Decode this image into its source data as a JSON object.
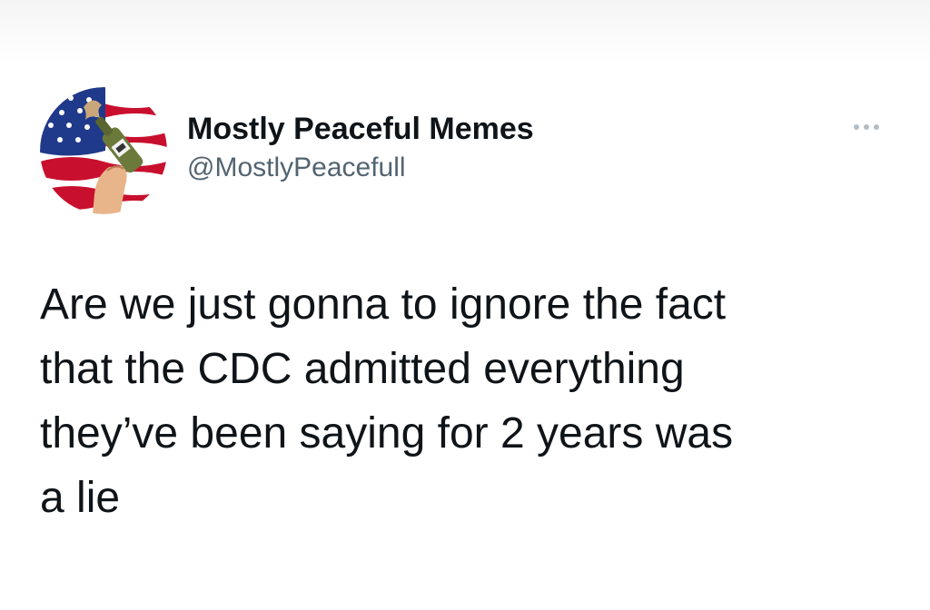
{
  "tweet": {
    "author": {
      "display_name": "Mostly Peaceful Memes",
      "handle": "@MostlyPeacefull",
      "avatar_icon": "flag-bottle-avatar-icon"
    },
    "more_icon": "more-options-icon",
    "text": "Are we just gonna to ignore the fact\nthat the CDC admitted everything\nthey’ve been saying for 2 years was\na lie"
  },
  "colors": {
    "text_primary": "#0f1419",
    "text_secondary": "#536471",
    "flag_red": "#c8102e",
    "flag_blue": "#1f3a8a"
  }
}
